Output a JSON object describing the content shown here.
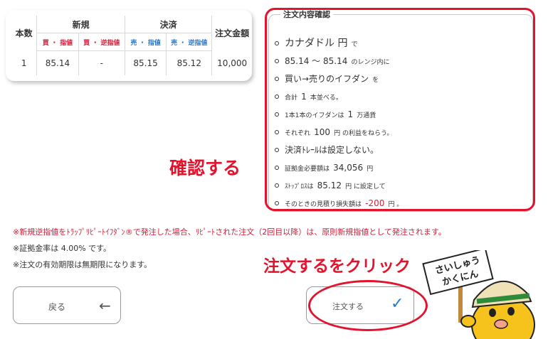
{
  "table": {
    "headers": {
      "count": "本数",
      "new": "新規",
      "settle": "決済",
      "amount": "注文金額",
      "new_sub1": "買 ・ 指値",
      "new_sub2": "買 ・ 逆指値",
      "settle_sub1": "売 ・ 指値",
      "settle_sub2": "売 ・ 逆指値"
    },
    "row": {
      "count": "1",
      "new_limit": "85.14",
      "new_stop": "-",
      "settle_limit": "85.15",
      "settle_stop": "85.12",
      "amount": "10,000"
    }
  },
  "confirm": {
    "title": "注文内容確認",
    "items": {
      "currency": "カナダドル 円",
      "currency_suffix": "で",
      "range": "85.14 ～ 85.14",
      "range_suffix": "のレンジ内に",
      "ifdone": "買い→売りのイフダン",
      "ifdone_suffix": "を",
      "total_prefix": "合計",
      "total_value": "1",
      "total_suffix": "本並べる。",
      "each_prefix": "1本1本のイフダンは",
      "each_value": "1",
      "each_suffix": "万通貨",
      "profit_prefix": "それぞれ",
      "profit_value": "100",
      "profit_suffix": "円 の利益をねらう。",
      "trail": "決済ﾄﾚｰﾙは設定しない。",
      "margin_prefix": "証拠金必要額は",
      "margin_value": "34,056",
      "margin_suffix": "円",
      "stop_prefix": "ｽﾄｯﾌﾟﾛｽは",
      "stop_value": "85.12",
      "stop_suffix": "円 に設定して",
      "loss_prefix": "そのときの見積り損失額は",
      "loss_value": "-200",
      "loss_suffix": "円 。"
    }
  },
  "annotations": {
    "confirm": "確認する",
    "click": "注文するをクリック",
    "sign_line1": "さいしゅう",
    "sign_line2": "かくにん"
  },
  "notes": {
    "warning": "※新規逆指値をﾄﾗｯﾌﾟﾘﾋﾟｰﾄｲﾌﾀﾞﾝ®で発注した場合、ﾘﾋﾟｰﾄされた注文（2回目以降）は、原則新規指値として発注されます。",
    "margin_rate": "※証拠金率は 4.00%  です。",
    "validity": "※注文の有効期限は無期限になります。"
  },
  "buttons": {
    "back": "戻る",
    "order": "注文する"
  },
  "colors": {
    "accent_red": "#e3132d",
    "buy_red": "#d0203a",
    "sell_blue": "#2a78c9"
  }
}
